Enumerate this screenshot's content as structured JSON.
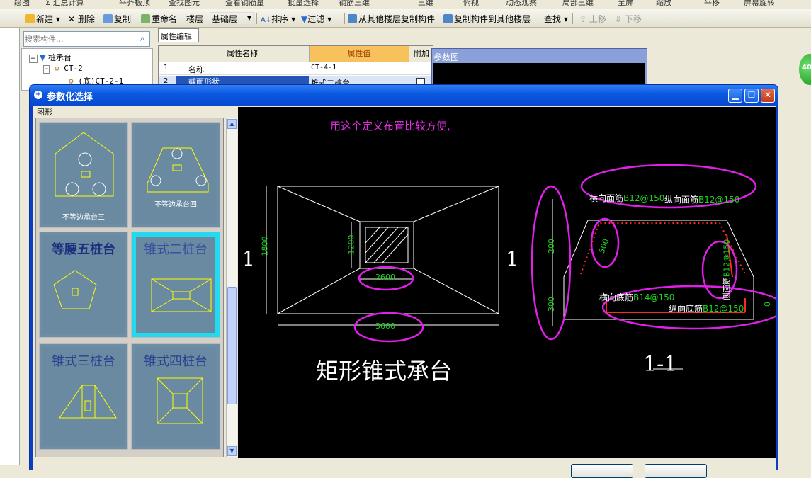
{
  "menubar": {
    "items": [
      "绘图",
      "Σ 汇总计算",
      "平齐板顶",
      "查找图元",
      "查看钢筋量",
      "批量选择",
      "钢筋三维",
      "三维",
      "俯视",
      "动态观察",
      "局部三维",
      "全屏",
      "缩放",
      "平移",
      "屏幕旋转"
    ]
  },
  "toolbar": {
    "new": "新建",
    "delete": "删除",
    "copy": "复制",
    "rename": "重命名",
    "floor_label": "楼层",
    "floor_value": "基础层",
    "sort": "排序",
    "filter": "过滤",
    "copy_from": "从其他楼层复制构件",
    "copy_to": "复制构件到其他楼层",
    "find": "查找",
    "move_up": "上移",
    "move_down": "下移"
  },
  "left_strip": {
    "close": "×"
  },
  "search": {
    "placeholder": "搜索构件..."
  },
  "tree": {
    "items": [
      {
        "label": "桩承台",
        "level": 0
      },
      {
        "label": "CT-2",
        "level": 1
      },
      {
        "label": "(底)CT-2-1",
        "level": 2
      }
    ]
  },
  "properties": {
    "tab": "属性编辑",
    "headers": [
      "属性名称",
      "属性值",
      "附加"
    ],
    "rows": [
      {
        "num": "1",
        "name": "名称",
        "value": "CT-4-1"
      },
      {
        "num": "2",
        "name": "截面形状",
        "value": "锥式二桩台"
      }
    ]
  },
  "param_panel": {
    "title": "参数图"
  },
  "badge": {
    "value": "40"
  },
  "dialog": {
    "title": "参数化选择",
    "group_label": "图形",
    "thumbnails": [
      {
        "label": "不等边承台三",
        "style": "small"
      },
      {
        "label": "不等边承台四",
        "style": "small"
      },
      {
        "label": "等腰五桩台",
        "style": "big"
      },
      {
        "label": "锥式二桩台",
        "style": "big",
        "selected": true
      },
      {
        "label": "锥式三桩台",
        "style": "big"
      },
      {
        "label": "锥式四桩台",
        "style": "big"
      }
    ],
    "canvas": {
      "note": "用这个定义布置比较方便,",
      "section_mark": "1",
      "dim_width_outer": "3600",
      "dim_width_inner": "2600",
      "dim_height_outer": "1800",
      "dim_height_inner": "1200",
      "plan_title": "矩形锥式承台",
      "section_title": "1-1",
      "top_bar_h_label": "横向面筋",
      "top_bar_h_value": "B12@150",
      "top_bar_v_label": "纵向面筋",
      "top_bar_v_value": "B12@150",
      "side_bar_label": "侧面筋",
      "side_bar_value": "B12@150",
      "bottom_bar_h_label": "横向底筋",
      "bottom_bar_h_value": "B14@150",
      "bottom_bar_v_label": "纵向底筋",
      "bottom_bar_v_value": "B12@150",
      "dim_section_top": "200",
      "dim_section_bottom": "300",
      "dim_slope": "500",
      "dim_cover": "0"
    }
  },
  "colors": {
    "annotation_circle": "#e020e8",
    "note_text": "#e030e0",
    "dim_text": "#20d020",
    "rebar": "#ff2a1a",
    "thumb_bg": "#6d8ea5",
    "selected_thumb": "#23d9f0"
  }
}
